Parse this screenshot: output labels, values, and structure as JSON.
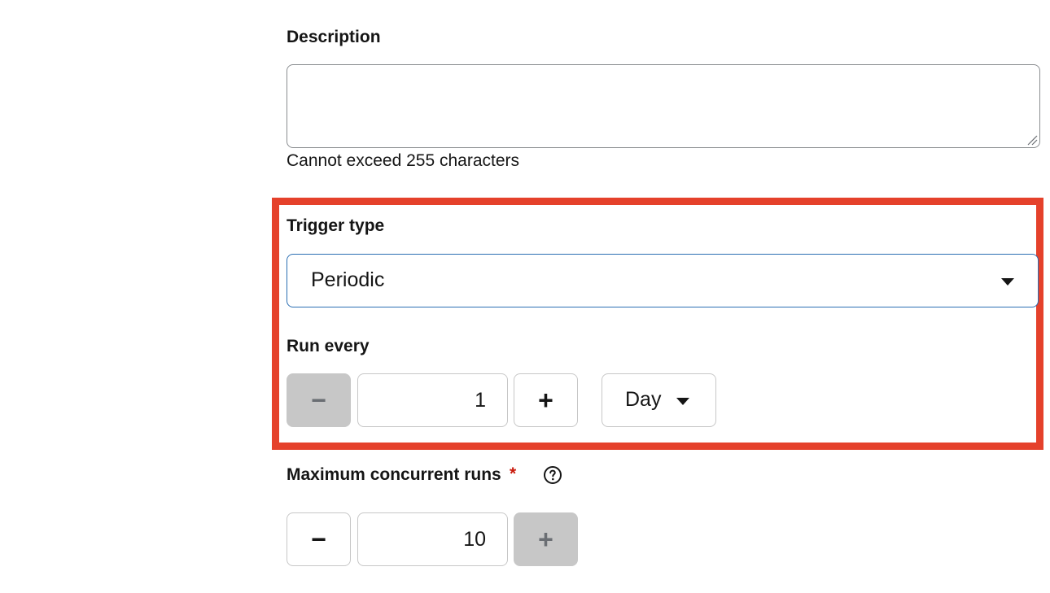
{
  "description": {
    "label": "Description",
    "value": "",
    "helper_text": "Cannot exceed 255 characters"
  },
  "trigger": {
    "label": "Trigger type",
    "selected": "Periodic"
  },
  "run_every": {
    "label": "Run every",
    "value": "1",
    "minus_label": "−",
    "plus_label": "+",
    "unit": "Day"
  },
  "max_concurrent": {
    "label": "Maximum concurrent runs",
    "required_marker": "*",
    "value": "10",
    "minus_label": "−",
    "plus_label": "+"
  },
  "colors": {
    "highlight": "#e5412b",
    "focus_border": "#2b6fb3",
    "required": "#c9190b",
    "disabled_bg": "#c7c7c7"
  },
  "icons": {
    "help": "question-circle-icon",
    "caret": "caret-down-icon",
    "resize": "resize-grip-icon"
  }
}
